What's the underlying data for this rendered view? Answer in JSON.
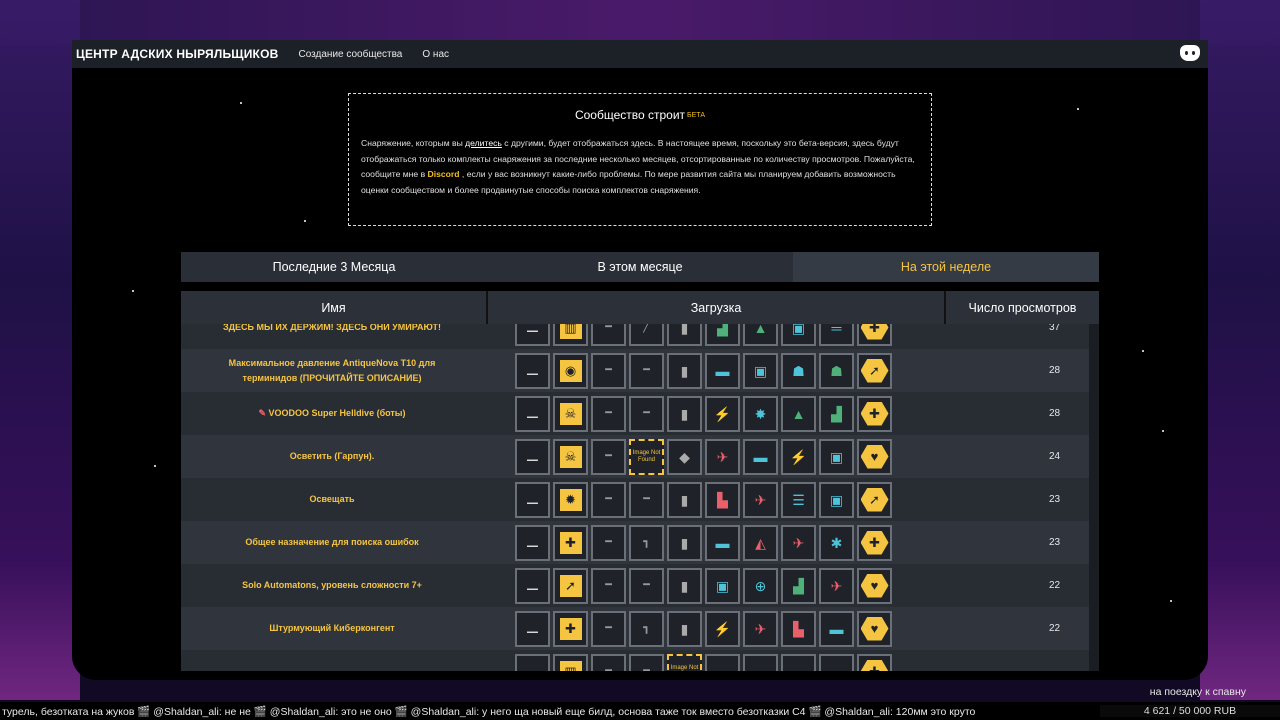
{
  "nav": {
    "brand": "ЦЕНТР АДСКИХ НЫРЯЛЬЩИКОВ",
    "links": [
      "Создание сообщества",
      "О нас"
    ]
  },
  "info": {
    "title": "Сообщество строит",
    "beta": "БЕТА",
    "text_1": "Снаряжение, которым вы ",
    "share_link": "делитесь",
    "text_2": " с другими, будет отображаться здесь. В настоящее время, поскольку это бета-версия, здесь будут отображаться только комплекты снаряжения за последние несколько месяцев, отсортированные по количеству просмотров. Пожалуйста, сообщите мне в ",
    "discord_link": "Discord",
    "text_3": " , если у вас возникнут какие-либо проблемы. По мере развития сайта мы планируем добавить возможность оценки сообществом и более продвинутые способы поиска комплектов снаряжения."
  },
  "tabs": [
    "Последние 3 Месяца",
    "В этом месяце",
    "На этой неделе"
  ],
  "active_tab": "На этой неделе",
  "table": {
    "headers": [
      "Имя",
      "Загрузка",
      "Число просмотров"
    ],
    "rows": [
      {
        "name": "ЗДЕСЬ МЫ ИХ ДЕРЖИМ! ЗДЕСЬ ОНИ УМИРАЮТ!",
        "views": "37"
      },
      {
        "name": "Максимальное давление AntiqueNova T10 для терминидов (ПРОЧИТАЙТЕ ОПИСАНИЕ)",
        "views": "28"
      },
      {
        "name": "VOODOO Super Helldive (боты)",
        "views": "28"
      },
      {
        "name": "Осветить (Гарпун).",
        "views": "24"
      },
      {
        "name": "Освещать",
        "views": "23"
      },
      {
        "name": "Общее назначение для поиска ошибок",
        "views": "23"
      },
      {
        "name": "Solo Automatons, уровень сложности 7+",
        "views": "22"
      },
      {
        "name": "Штурмующий Киберконгент",
        "views": "22"
      },
      {
        "name": "",
        "views": ""
      }
    ]
  },
  "image_not_found": "Image Not Found",
  "chat": "турель, безотката на жуков 🎬 @Shaldan_ali: не не 🎬 @Shaldan_ali: это не оно 🎬 @Shaldan_ali: у него ща новый еще билд, основа таже ток вместо безотказки С4 🎬 @Shaldan_ali: 120мм это круто",
  "donation": {
    "title": "на поездку к спавну",
    "amount": "4 621 / 50 000 RUB"
  },
  "colors": {
    "accent": "#f5c542",
    "red_strat": "#e8606a",
    "teal_strat": "#4fc3d8",
    "green_strat": "#4fb07a"
  }
}
